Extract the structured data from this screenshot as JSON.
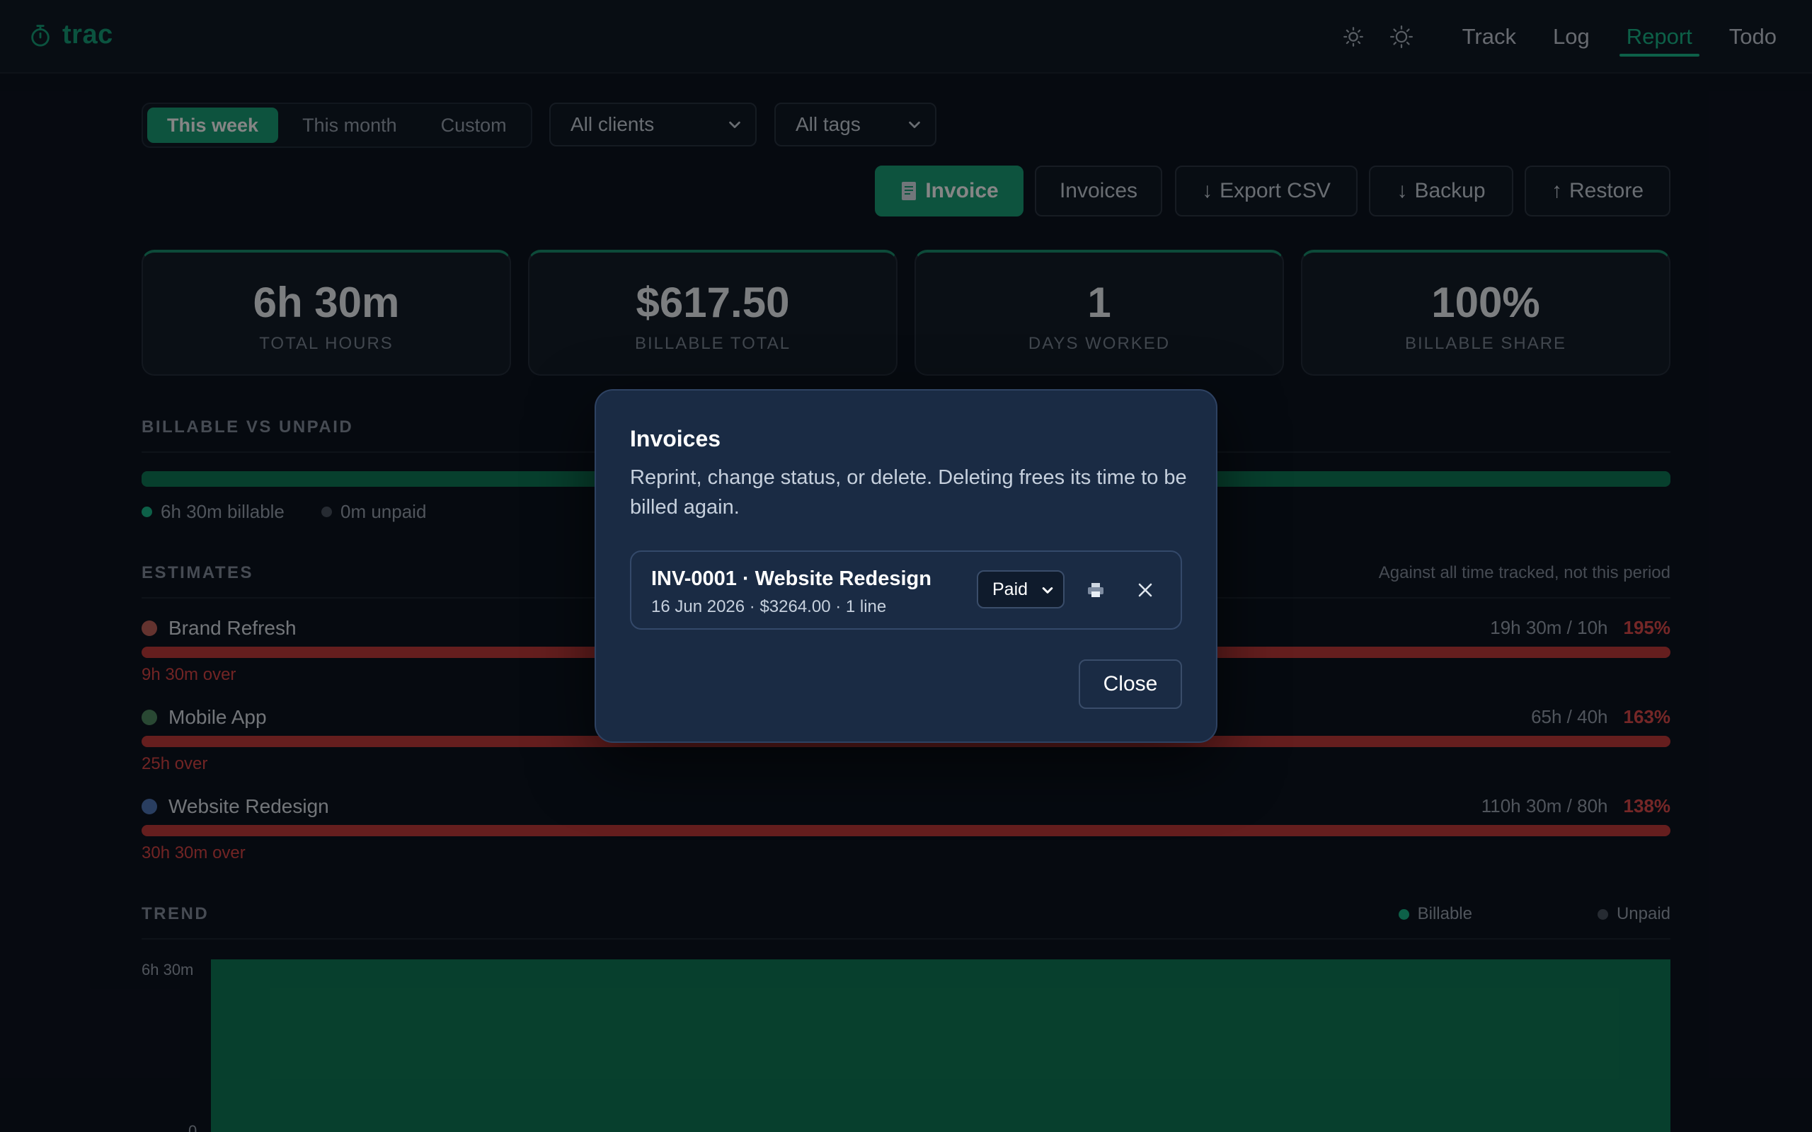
{
  "app": {
    "name": "trac"
  },
  "nav": {
    "items": [
      {
        "label": "Track",
        "active": false
      },
      {
        "label": "Log",
        "active": false
      },
      {
        "label": "Report",
        "active": true
      },
      {
        "label": "Todo",
        "active": false
      }
    ]
  },
  "theme": {
    "icons": [
      "sun-dim-icon",
      "sun-icon"
    ]
  },
  "filters": {
    "periods": [
      {
        "label": "This week",
        "active": true
      },
      {
        "label": "This month",
        "active": false
      },
      {
        "label": "Custom",
        "active": false
      }
    ],
    "client_select": "All clients",
    "tag_select": "All tags"
  },
  "actions": {
    "invoice": "Invoice",
    "invoices": "Invoices",
    "export_csv": "Export CSV",
    "backup": "Backup",
    "restore": "Restore"
  },
  "stats": [
    {
      "value": "6h 30m",
      "label": "TOTAL HOURS"
    },
    {
      "value": "$617.50",
      "label": "BILLABLE TOTAL"
    },
    {
      "value": "1",
      "label": "DAYS WORKED"
    },
    {
      "value": "100%",
      "label": "BILLABLE SHARE"
    }
  ],
  "billable": {
    "heading": "BILLABLE VS UNPAID",
    "billable_label": "6h 30m billable",
    "unpaid_label": "0m unpaid",
    "billable_fraction": 1.0
  },
  "estimates": {
    "heading": "ESTIMATES",
    "note": "Against all time tracked, not this period",
    "items": [
      {
        "name": "Brand Refresh",
        "ratio": "19h 30m / 10h",
        "pct": "195%",
        "over": "9h 30m over",
        "color": "#c0625a"
      },
      {
        "name": "Mobile App",
        "ratio": "65h / 40h",
        "pct": "163%",
        "over": "25h over",
        "color": "#4f8a62"
      },
      {
        "name": "Website Redesign",
        "ratio": "110h 30m / 80h",
        "pct": "138%",
        "over": "30h 30m over",
        "color": "#4f77b8"
      }
    ]
  },
  "trend": {
    "heading": "TREND",
    "legend_billable": "Billable",
    "legend_unpaid": "Unpaid",
    "y_top": "6h 30m",
    "y_bottom": "0"
  },
  "colors": {
    "accent": "#1a9f78",
    "danger": "#d84545",
    "modal_bg": "#1a2b44"
  },
  "modal": {
    "title": "Invoices",
    "description": "Reprint, change status, or delete. Deleting frees its time to be billed again.",
    "invoice": {
      "title": "INV-0001 · Website Redesign",
      "meta": "16 Jun 2026 · $3264.00 · 1 line",
      "status": "Paid"
    },
    "close": "Close"
  }
}
